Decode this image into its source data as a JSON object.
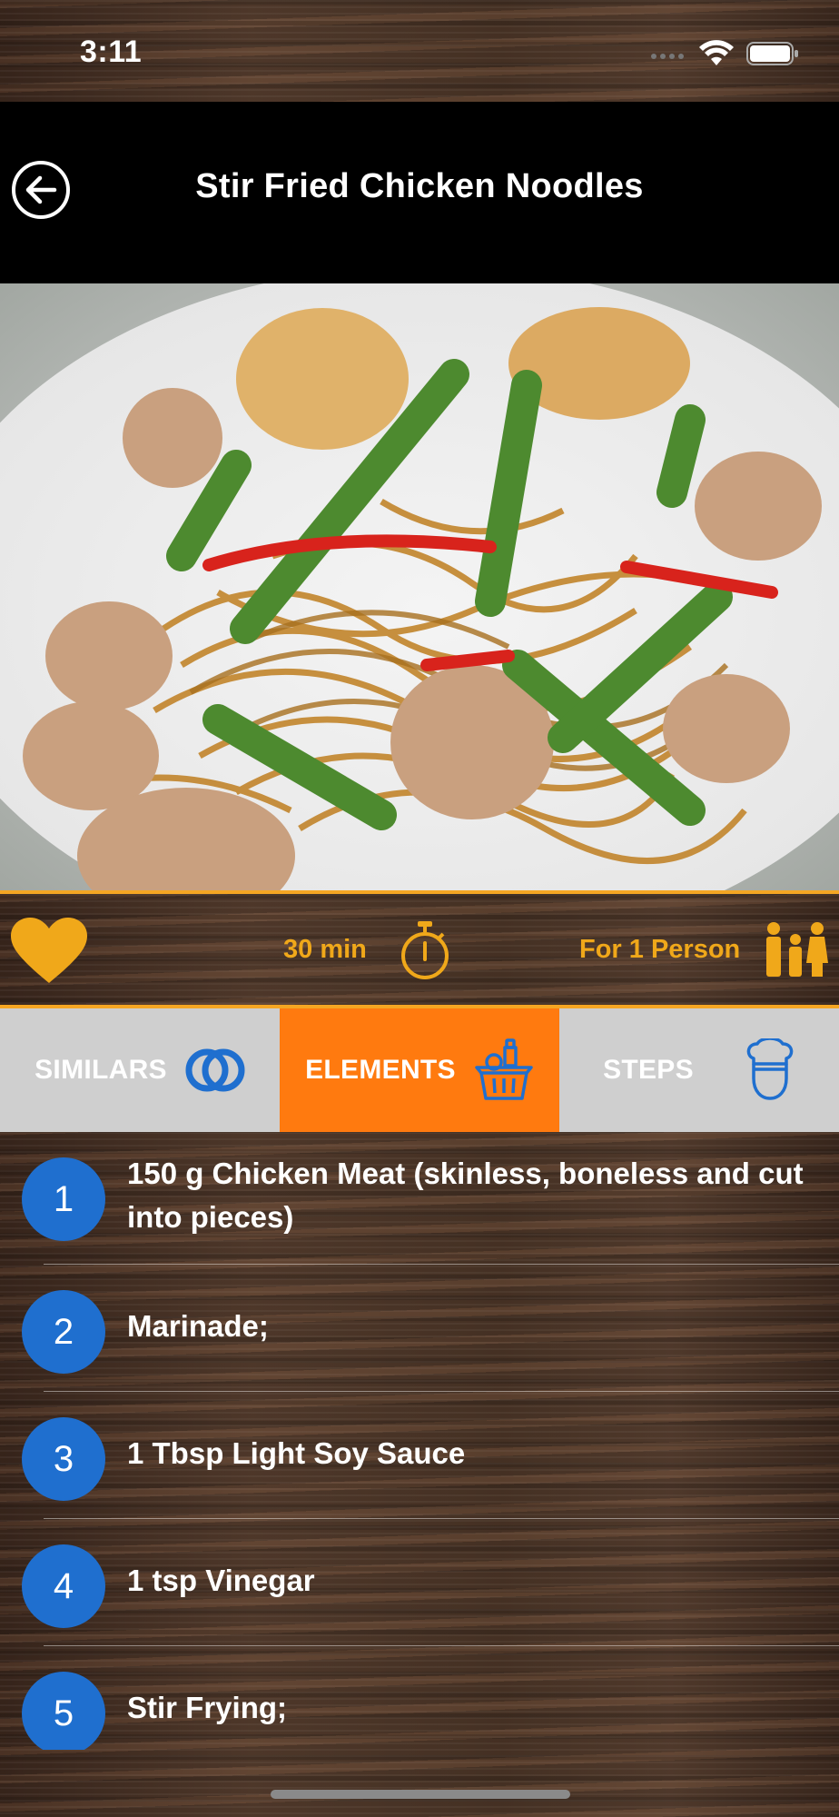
{
  "status_bar": {
    "time": "3:11"
  },
  "header": {
    "title": "Stir Fried Chicken Noodles"
  },
  "info": {
    "time": "30 min",
    "persons": "For 1 Person"
  },
  "tabs": [
    {
      "label": "SIMILARS",
      "icon": "rings-icon",
      "active": false
    },
    {
      "label": "ELEMENTS",
      "icon": "basket-icon",
      "active": true
    },
    {
      "label": "STEPS",
      "icon": "chef-icon",
      "active": false
    }
  ],
  "ingredients": [
    {
      "number": "1",
      "text": "150 g Chicken Meat (skinless, boneless and cut into pieces)"
    },
    {
      "number": "2",
      "text": "Marinade;"
    },
    {
      "number": "3",
      "text": "1 Tbsp Light Soy Sauce"
    },
    {
      "number": "4",
      "text": "1 tsp Vinegar"
    },
    {
      "number": "5",
      "text": "Stir Frying;"
    }
  ],
  "colors": {
    "accent": "#f0a81a",
    "active_tab": "#ff7a0f",
    "number_badge": "#1f6fcf",
    "inactive_tab": "#cfcfcf",
    "header": "#000000"
  }
}
